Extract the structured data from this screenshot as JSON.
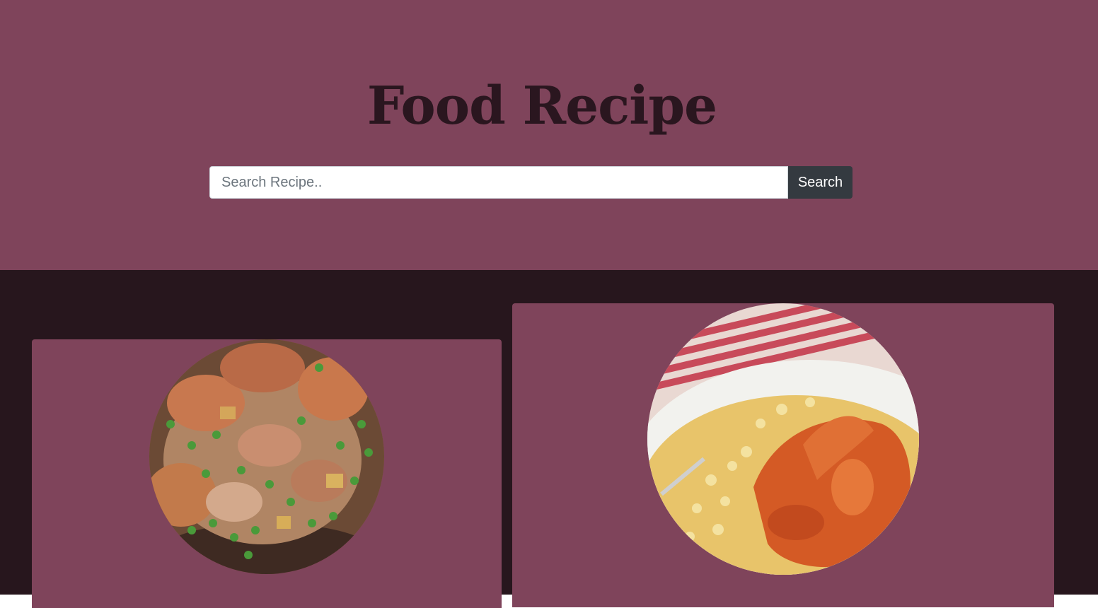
{
  "header": {
    "title": "Food Recipe"
  },
  "search": {
    "placeholder": "Search Recipe..",
    "value": "",
    "button_label": "Search"
  },
  "recipes": [
    {
      "image_icon": "chicken-peas-stew-photo"
    },
    {
      "image_icon": "chicken-curry-rice-photo"
    }
  ],
  "colors": {
    "hero_bg": "#7f445b",
    "results_bg": "#27161d",
    "card_bg": "#7f445b",
    "title_color": "#2a161f",
    "button_bg": "#343a40"
  }
}
